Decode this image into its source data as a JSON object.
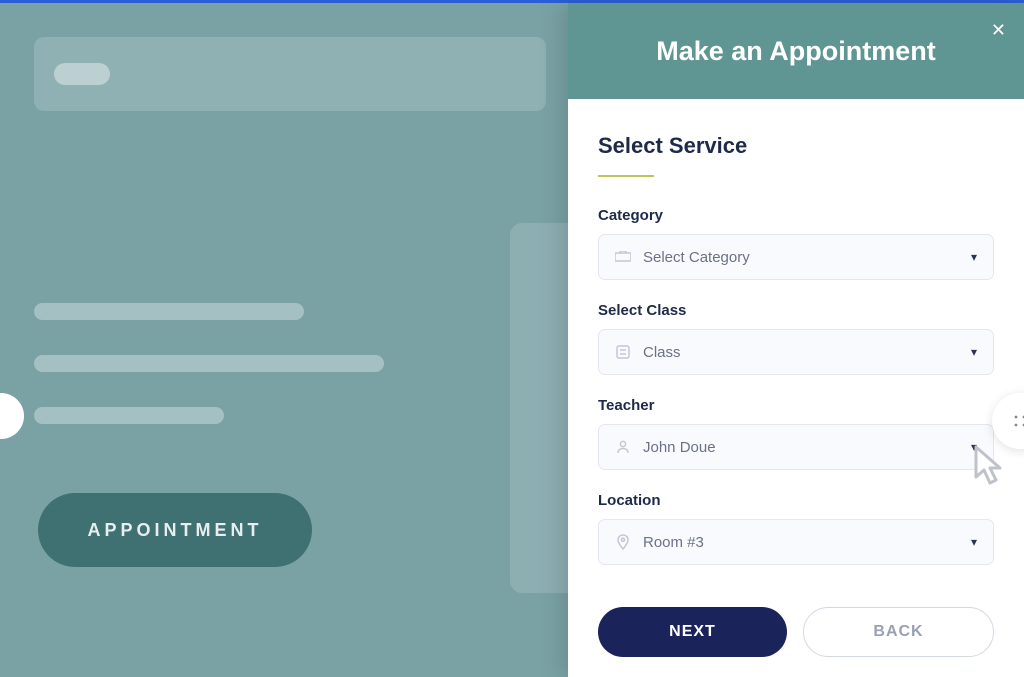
{
  "background": {
    "appointment_button_label": "APPOINTMENT"
  },
  "drawer": {
    "title": "Make an Appointment",
    "section_title": "Select Service",
    "fields": {
      "category": {
        "label": "Category",
        "value": "Select Category"
      },
      "class": {
        "label": "Select Class",
        "value": "Class"
      },
      "teacher": {
        "label": "Teacher",
        "value": "John Doue"
      },
      "location": {
        "label": "Location",
        "value": "Room #3"
      }
    },
    "buttons": {
      "next": "NEXT",
      "back": "BACK"
    }
  }
}
